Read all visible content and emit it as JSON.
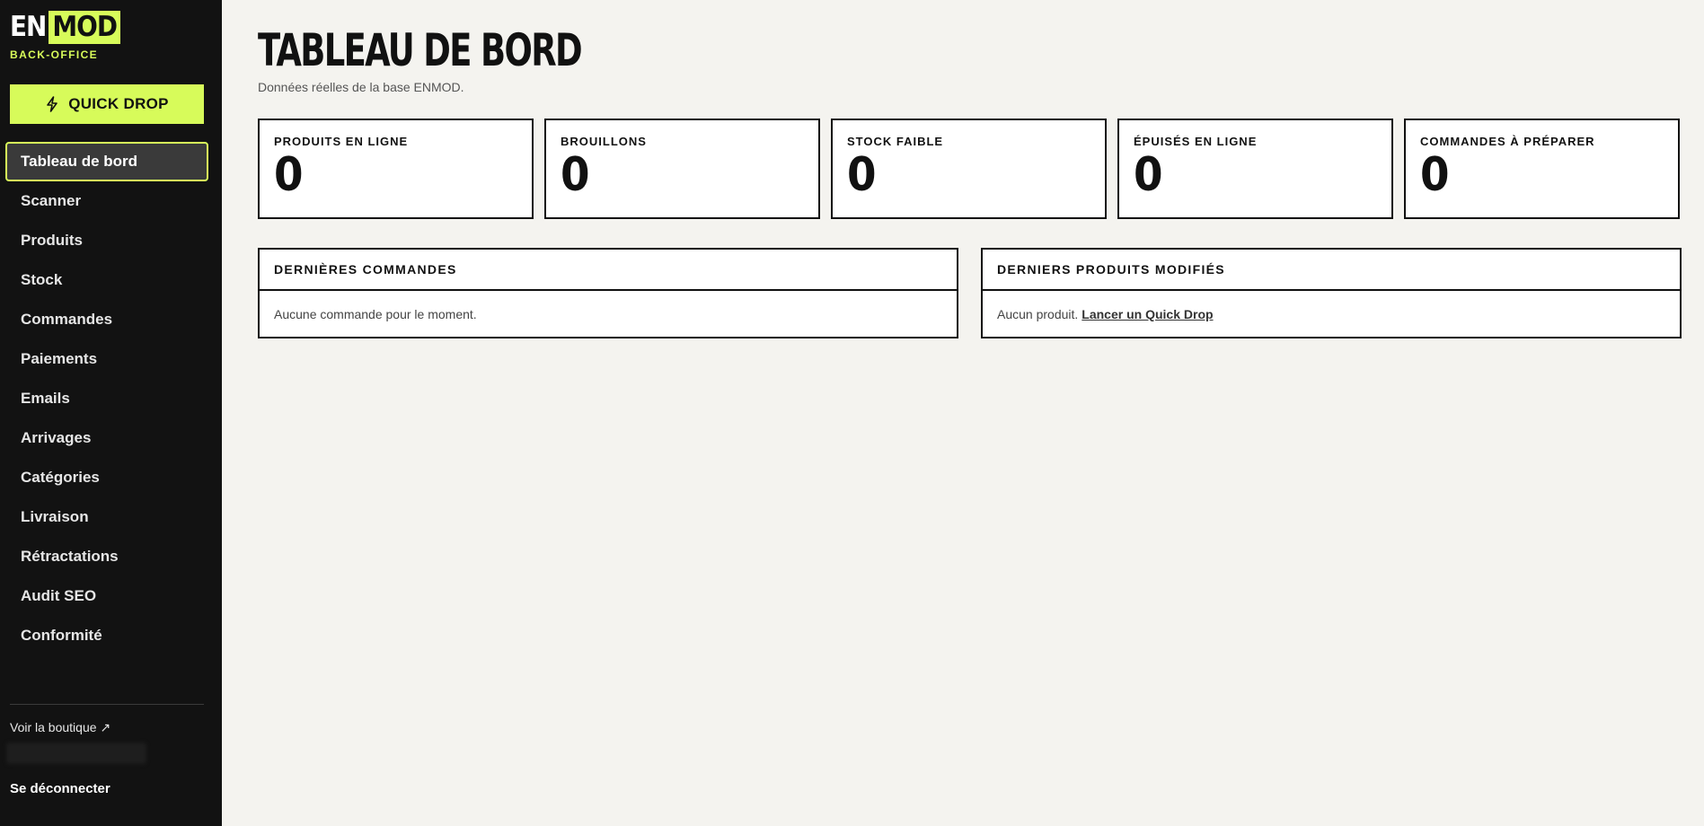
{
  "brand": {
    "logo_left": "EN",
    "logo_right": "MOD",
    "tagline": "BACK-OFFICE",
    "accent": "#d7fb5a"
  },
  "sidebar": {
    "quick_drop_label": "QUICK DROP",
    "quick_drop_icon": "lightning-icon",
    "items": [
      {
        "label": "Tableau de bord",
        "active": true
      },
      {
        "label": "Scanner"
      },
      {
        "label": "Produits"
      },
      {
        "label": "Stock"
      },
      {
        "label": "Commandes"
      },
      {
        "label": "Paiements"
      },
      {
        "label": "Emails"
      },
      {
        "label": "Arrivages"
      },
      {
        "label": "Catégories"
      },
      {
        "label": "Livraison"
      },
      {
        "label": "Rétractations"
      },
      {
        "label": "Audit SEO"
      },
      {
        "label": "Conformité"
      }
    ],
    "boutique_link": "Voir la boutique ↗",
    "logout": "Se déconnecter"
  },
  "main": {
    "title": "TABLEAU DE BORD",
    "subtitle": "Données réelles de la base ENMOD.",
    "stats": [
      {
        "label": "PRODUITS EN LIGNE",
        "value": "0"
      },
      {
        "label": "BROUILLONS",
        "value": "0"
      },
      {
        "label": "STOCK FAIBLE",
        "value": "0"
      },
      {
        "label": "ÉPUISÉS EN LIGNE",
        "value": "0"
      },
      {
        "label": "COMMANDES À PRÉPARER",
        "value": "0"
      }
    ],
    "panels": {
      "orders": {
        "title": "DERNIÈRES COMMANDES",
        "empty": "Aucune commande pour le moment."
      },
      "products": {
        "title": "DERNIERS PRODUITS MODIFIÉS",
        "empty": "Aucun produit.",
        "link": "Lancer un Quick Drop"
      }
    }
  }
}
